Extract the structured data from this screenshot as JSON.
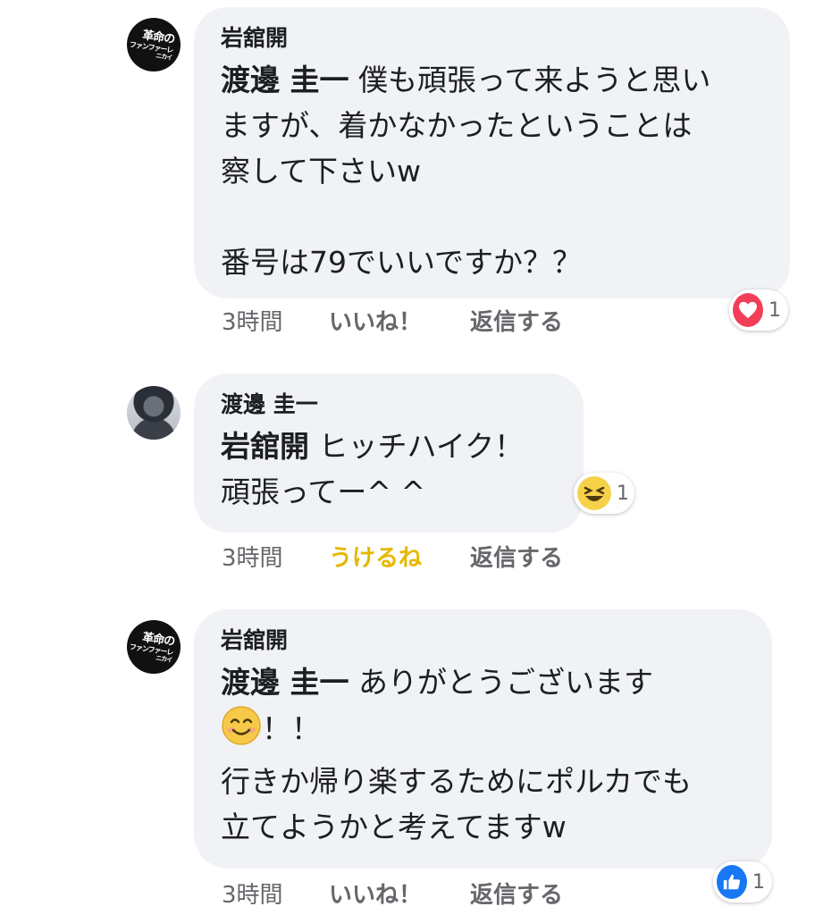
{
  "comments": [
    {
      "author": "岩舘開",
      "mention": "渡邊 圭一",
      "text": " 僕も頑張って来ようと思い\nますが、着かなかったということは\n察して下さいw\n\n番号は79でいいですか？？",
      "time": "3時間",
      "like_label": "いいね！",
      "reply_label": "返信する",
      "reaction": {
        "icon": "heart-icon",
        "count": "1"
      },
      "avatar_text": [
        "革命の",
        "ファンファーレ",
        "ニカイ"
      ]
    },
    {
      "author": "渡邊 圭一",
      "mention": "岩舘開",
      "text": " ヒッチハイク！\n頑張ってー^ ^",
      "time": "3時間",
      "like_label": "うけるね",
      "reply_label": "返信する",
      "reaction": {
        "icon": "laughing-face-icon",
        "count": "1"
      }
    },
    {
      "author": "岩舘開",
      "mention": "渡邊 圭一",
      "text_line1": " ありがとうございます",
      "text_after_emoji": "！！",
      "text_rest": "行きか帰り楽するためにポルカでも\n立てようかと考えてますw",
      "time": "3時間",
      "like_label": "いいね！",
      "reply_label": "返信する",
      "reaction": {
        "icon": "thumbs-up-icon",
        "count": "1"
      },
      "avatar_text": [
        "革命の",
        "ファンファーレ",
        "ニカイ"
      ]
    }
  ],
  "colors": {
    "bubble": "#f0f2f5",
    "meta_text": "#65676b",
    "haha_label": "#e6b800",
    "love": "#f33e58",
    "like": "#1877f2"
  }
}
